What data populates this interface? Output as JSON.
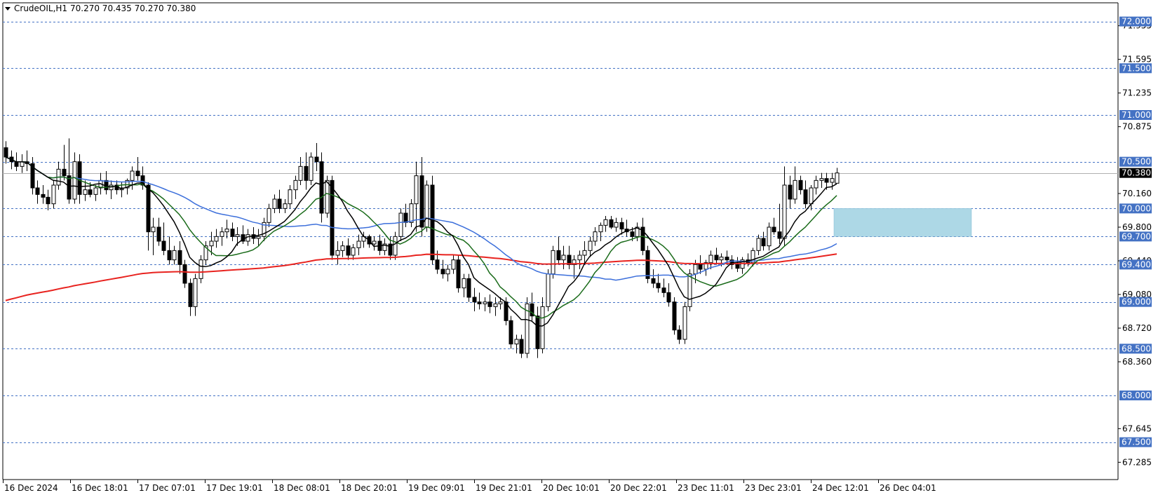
{
  "header": {
    "symbol": "CrudeOIL,H1",
    "ohlc": "70.270 70.435 70.270 70.380"
  },
  "chart_data": {
    "type": "candlestick",
    "ylim": [
      67.1,
      72.2
    ],
    "price_ticks": [
      "71.955",
      "71.595",
      "71.235",
      "70.875",
      "70.160",
      "69.800",
      "69.440",
      "69.080",
      "68.720",
      "68.360",
      "67.645",
      "67.285"
    ],
    "level_lines": [
      {
        "value": 72.0,
        "label": "72.000"
      },
      {
        "value": 71.5,
        "label": "71.500"
      },
      {
        "value": 71.0,
        "label": "71.000"
      },
      {
        "value": 70.5,
        "label": "70.500"
      },
      {
        "value": 70.0,
        "label": "70.000"
      },
      {
        "value": 69.7,
        "label": "69.700"
      },
      {
        "value": 69.4,
        "label": "69.400"
      },
      {
        "value": 69.0,
        "label": "69.000"
      },
      {
        "value": 68.5,
        "label": "68.500"
      },
      {
        "value": 68.0,
        "label": "68.000"
      },
      {
        "value": 67.5,
        "label": "67.500"
      }
    ],
    "current_price": {
      "value": 70.38,
      "label": "70.380"
    },
    "time_labels": [
      "16 Dec 2024",
      "16 Dec 18:01",
      "17 Dec 07:01",
      "17 Dec 19:01",
      "18 Dec 08:01",
      "18 Dec 20:01",
      "19 Dec 09:01",
      "19 Dec 21:01",
      "20 Dec 10:01",
      "20 Dec 22:01",
      "23 Dec 11:01",
      "23 Dec 23:01",
      "24 Dec 12:01",
      "26 Dec 04:01"
    ],
    "zone": {
      "low": 69.7,
      "high": 70.0,
      "from_bar": 158
    },
    "colors": {
      "level_line": "#4472C4",
      "level_label_bg": "#4472C4",
      "zone_fill": "#ADD8E6",
      "ma_fast": "#000000",
      "ma_mid": "#1A6B1A",
      "ma_slow": "#3C6FDB",
      "ma_long": "#E8231F",
      "candle": "#000000"
    },
    "candles": [
      [
        70.65,
        70.72,
        70.48,
        70.55
      ],
      [
        70.55,
        70.62,
        70.42,
        70.5
      ],
      [
        70.5,
        70.6,
        70.4,
        70.45
      ],
      [
        70.45,
        70.58,
        70.38,
        70.5
      ],
      [
        70.5,
        70.62,
        70.4,
        70.48
      ],
      [
        70.48,
        70.55,
        70.15,
        70.22
      ],
      [
        70.22,
        70.3,
        70.05,
        70.15
      ],
      [
        70.15,
        70.25,
        70.05,
        70.12
      ],
      [
        70.12,
        70.2,
        69.98,
        70.05
      ],
      [
        70.05,
        70.3,
        70.0,
        70.25
      ],
      [
        70.25,
        70.5,
        70.2,
        70.42
      ],
      [
        70.42,
        70.68,
        70.3,
        70.35
      ],
      [
        70.35,
        70.75,
        70.05,
        70.1
      ],
      [
        70.1,
        70.6,
        70.05,
        70.5
      ],
      [
        70.5,
        70.58,
        70.05,
        70.15
      ],
      [
        70.15,
        70.3,
        70.08,
        70.2
      ],
      [
        70.2,
        70.28,
        70.12,
        70.15
      ],
      [
        70.15,
        70.25,
        70.08,
        70.22
      ],
      [
        70.22,
        70.38,
        70.15,
        70.3
      ],
      [
        70.3,
        70.4,
        70.15,
        70.2
      ],
      [
        70.2,
        70.3,
        70.1,
        70.25
      ],
      [
        70.25,
        70.3,
        70.15,
        70.2
      ],
      [
        70.2,
        70.28,
        70.12,
        70.22
      ],
      [
        70.22,
        70.32,
        70.15,
        70.3
      ],
      [
        70.3,
        70.45,
        70.2,
        70.4
      ],
      [
        70.4,
        70.55,
        70.3,
        70.35
      ],
      [
        70.35,
        70.45,
        70.2,
        70.25
      ],
      [
        70.25,
        70.28,
        69.55,
        69.75
      ],
      [
        69.75,
        69.9,
        69.5,
        69.8
      ],
      [
        69.8,
        69.9,
        69.6,
        69.65
      ],
      [
        69.65,
        69.85,
        69.5,
        69.55
      ],
      [
        69.55,
        69.7,
        69.4,
        69.45
      ],
      [
        69.45,
        69.6,
        69.4,
        69.55
      ],
      [
        69.55,
        69.65,
        69.3,
        69.4
      ],
      [
        69.4,
        69.45,
        69.15,
        69.2
      ],
      [
        69.2,
        69.25,
        68.85,
        68.95
      ],
      [
        68.95,
        69.3,
        68.85,
        69.25
      ],
      [
        69.25,
        69.5,
        69.2,
        69.45
      ],
      [
        69.45,
        69.65,
        69.4,
        69.6
      ],
      [
        69.6,
        69.75,
        69.5,
        69.65
      ],
      [
        69.65,
        69.78,
        69.58,
        69.7
      ],
      [
        69.7,
        69.8,
        69.6,
        69.75
      ],
      [
        69.75,
        69.88,
        69.68,
        69.78
      ],
      [
        69.78,
        69.85,
        69.65,
        69.7
      ],
      [
        69.7,
        69.8,
        69.6,
        69.72
      ],
      [
        69.72,
        69.82,
        69.62,
        69.65
      ],
      [
        69.65,
        69.78,
        69.6,
        69.72
      ],
      [
        69.72,
        69.8,
        69.62,
        69.68
      ],
      [
        69.68,
        69.78,
        69.6,
        69.7
      ],
      [
        69.7,
        69.9,
        69.65,
        69.85
      ],
      [
        69.85,
        70.05,
        69.8,
        70.0
      ],
      [
        70.0,
        70.15,
        69.95,
        70.1
      ],
      [
        70.1,
        70.2,
        69.95,
        70.0
      ],
      [
        70.0,
        70.1,
        69.95,
        70.05
      ],
      [
        70.05,
        70.25,
        70.0,
        70.2
      ],
      [
        70.2,
        70.35,
        70.1,
        70.3
      ],
      [
        70.3,
        70.55,
        70.25,
        70.45
      ],
      [
        70.45,
        70.6,
        70.2,
        70.3
      ],
      [
        70.3,
        70.6,
        70.25,
        70.55
      ],
      [
        70.55,
        70.7,
        70.4,
        70.5
      ],
      [
        70.5,
        70.6,
        69.85,
        69.95
      ],
      [
        69.95,
        70.35,
        69.9,
        70.3
      ],
      [
        70.3,
        70.35,
        69.45,
        69.5
      ],
      [
        69.5,
        69.65,
        69.4,
        69.55
      ],
      [
        69.55,
        69.65,
        69.48,
        69.6
      ],
      [
        69.6,
        69.68,
        69.45,
        69.5
      ],
      [
        69.5,
        69.62,
        69.45,
        69.58
      ],
      [
        69.58,
        69.72,
        69.5,
        69.65
      ],
      [
        69.65,
        69.75,
        69.58,
        69.7
      ],
      [
        69.7,
        69.72,
        69.58,
        69.62
      ],
      [
        69.62,
        69.7,
        69.55,
        69.65
      ],
      [
        69.65,
        69.72,
        69.5,
        69.55
      ],
      [
        69.55,
        69.68,
        69.5,
        69.62
      ],
      [
        69.62,
        69.7,
        69.45,
        69.5
      ],
      [
        69.5,
        69.75,
        69.45,
        69.7
      ],
      [
        69.7,
        70.0,
        69.65,
        69.95
      ],
      [
        69.95,
        70.05,
        69.8,
        69.85
      ],
      [
        69.85,
        70.1,
        69.8,
        70.05
      ],
      [
        70.05,
        70.5,
        69.75,
        70.35
      ],
      [
        70.35,
        70.55,
        69.7,
        69.8
      ],
      [
        69.8,
        70.3,
        69.75,
        70.25
      ],
      [
        70.25,
        70.35,
        69.4,
        69.45
      ],
      [
        69.45,
        69.55,
        69.3,
        69.35
      ],
      [
        69.35,
        69.45,
        69.25,
        69.3
      ],
      [
        69.3,
        69.4,
        69.22,
        69.35
      ],
      [
        69.35,
        69.5,
        69.3,
        69.45
      ],
      [
        69.45,
        69.5,
        69.1,
        69.15
      ],
      [
        69.15,
        69.3,
        69.05,
        69.25
      ],
      [
        69.25,
        69.3,
        69.0,
        69.05
      ],
      [
        69.05,
        69.15,
        68.9,
        69.0
      ],
      [
        69.0,
        69.1,
        68.92,
        68.98
      ],
      [
        68.98,
        69.05,
        68.9,
        69.0
      ],
      [
        69.0,
        69.08,
        68.88,
        68.95
      ],
      [
        68.95,
        69.05,
        68.85,
        68.98
      ],
      [
        68.98,
        69.05,
        68.92,
        69.0
      ],
      [
        69.0,
        69.05,
        68.75,
        68.8
      ],
      [
        68.8,
        68.85,
        68.5,
        68.55
      ],
      [
        68.55,
        68.65,
        68.45,
        68.6
      ],
      [
        68.6,
        68.65,
        68.4,
        68.45
      ],
      [
        68.45,
        69.05,
        68.4,
        68.98
      ],
      [
        68.98,
        69.1,
        68.8,
        68.85
      ],
      [
        68.85,
        68.95,
        68.4,
        68.5
      ],
      [
        68.5,
        69.05,
        68.45,
        68.95
      ],
      [
        68.95,
        69.35,
        68.9,
        69.3
      ],
      [
        69.3,
        69.6,
        69.25,
        69.55
      ],
      [
        69.55,
        69.7,
        69.4,
        69.45
      ],
      [
        69.45,
        69.6,
        69.35,
        69.5
      ],
      [
        69.5,
        69.6,
        69.35,
        69.4
      ],
      [
        69.4,
        69.5,
        69.25,
        69.45
      ],
      [
        69.45,
        69.55,
        69.35,
        69.5
      ],
      [
        69.5,
        69.65,
        69.4,
        69.55
      ],
      [
        69.55,
        69.7,
        69.48,
        69.65
      ],
      [
        69.65,
        69.8,
        69.6,
        69.75
      ],
      [
        69.75,
        69.85,
        69.65,
        69.82
      ],
      [
        69.82,
        69.92,
        69.75,
        69.88
      ],
      [
        69.88,
        69.92,
        69.78,
        69.8
      ],
      [
        69.8,
        69.9,
        69.75,
        69.85
      ],
      [
        69.85,
        69.9,
        69.72,
        69.78
      ],
      [
        69.78,
        69.88,
        69.7,
        69.75
      ],
      [
        69.75,
        69.8,
        69.65,
        69.7
      ],
      [
        69.7,
        69.85,
        69.65,
        69.8
      ],
      [
        69.8,
        69.9,
        69.5,
        69.55
      ],
      [
        69.55,
        69.6,
        69.2,
        69.25
      ],
      [
        69.25,
        69.35,
        69.15,
        69.2
      ],
      [
        69.2,
        69.3,
        69.1,
        69.15
      ],
      [
        69.15,
        69.25,
        69.05,
        69.1
      ],
      [
        69.1,
        69.2,
        68.95,
        69.0
      ],
      [
        69.0,
        69.05,
        68.65,
        68.7
      ],
      [
        68.7,
        68.75,
        68.55,
        68.6
      ],
      [
        68.6,
        69.0,
        68.55,
        68.95
      ],
      [
        68.95,
        69.35,
        68.9,
        69.3
      ],
      [
        69.3,
        69.45,
        69.2,
        69.4
      ],
      [
        69.4,
        69.5,
        69.3,
        69.35
      ],
      [
        69.35,
        69.45,
        69.28,
        69.42
      ],
      [
        69.42,
        69.55,
        69.35,
        69.5
      ],
      [
        69.5,
        69.58,
        69.4,
        69.45
      ],
      [
        69.45,
        69.52,
        69.38,
        69.48
      ],
      [
        69.48,
        69.55,
        69.4,
        69.45
      ],
      [
        69.45,
        69.5,
        69.35,
        69.4
      ],
      [
        69.4,
        69.48,
        69.32,
        69.36
      ],
      [
        69.36,
        69.48,
        69.3,
        69.45
      ],
      [
        69.45,
        69.52,
        69.38,
        69.42
      ],
      [
        69.42,
        69.58,
        69.38,
        69.55
      ],
      [
        69.55,
        69.72,
        69.5,
        69.68
      ],
      [
        69.68,
        69.75,
        69.55,
        69.6
      ],
      [
        69.6,
        69.85,
        69.55,
        69.8
      ],
      [
        69.8,
        69.9,
        69.72,
        69.75
      ],
      [
        69.75,
        70.05,
        69.62,
        69.68
      ],
      [
        69.68,
        70.45,
        69.6,
        70.25
      ],
      [
        70.25,
        70.35,
        70.0,
        70.1
      ],
      [
        70.1,
        70.45,
        70.05,
        70.3
      ],
      [
        70.3,
        70.35,
        70.15,
        70.2
      ],
      [
        70.2,
        70.3,
        70.0,
        70.05
      ],
      [
        70.05,
        70.25,
        69.98,
        70.22
      ],
      [
        70.22,
        70.35,
        70.15,
        70.3
      ],
      [
        70.3,
        70.38,
        70.22,
        70.32
      ],
      [
        70.32,
        70.38,
        70.2,
        70.28
      ],
      [
        70.28,
        70.38,
        70.2,
        70.32
      ],
      [
        70.27,
        70.435,
        70.27,
        70.38
      ]
    ]
  }
}
